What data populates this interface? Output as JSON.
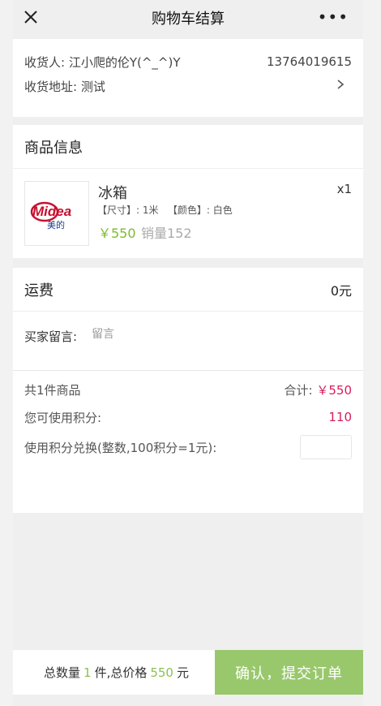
{
  "nav": {
    "title": "购物车结算",
    "more": "•••"
  },
  "address": {
    "receiver_label": "收货人:",
    "receiver_name": "江小爬的伦Y(^_^)Y",
    "phone": "13764019615",
    "address_label": "收货地址:",
    "address_value": "测试"
  },
  "goods": {
    "section_title": "商品信息",
    "items": [
      {
        "name": "冰箱",
        "quantity": "x1",
        "spec": "【尺寸】: 1米   【颜色】: 白色",
        "price": "￥550",
        "sales": "销量152",
        "logo_text": "Midea",
        "logo_sub": "美的"
      }
    ]
  },
  "freight": {
    "label": "运费",
    "value": "0元"
  },
  "message": {
    "label": "买家留言:",
    "placeholder": "留言"
  },
  "summary": {
    "count_text": "共1件商品",
    "total_label": "合计:",
    "total_value": "￥550",
    "points_label": "您可使用积分:",
    "points_value": "110",
    "exchange_label": "使用积分兑换(整数,100积分=1元):"
  },
  "bottom": {
    "qty_prefix": "总数量",
    "qty_value": "1",
    "qty_suffix": "件,总价格",
    "price_value": "550",
    "price_suffix": "元",
    "submit_label": "确认，提交订单"
  },
  "colors": {
    "accent_green": "#99c86c",
    "price_green": "#7dbb2e",
    "total_red": "#d81e5b"
  }
}
